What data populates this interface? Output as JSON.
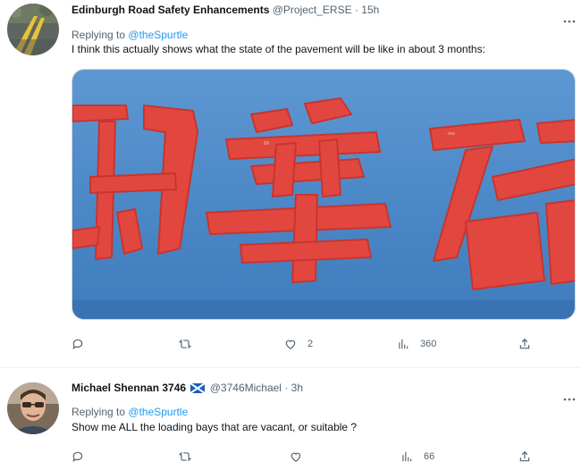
{
  "tweets": [
    {
      "display_name": "Edinburgh Road Safety Enhancements",
      "handle": "@Project_ERSE",
      "separator": "·",
      "time": "15h",
      "replying_prefix": "Replying to",
      "replying_mention": "@theSpurtle",
      "text": "I think this actually shows what the state of the pavement will be like in about 3 months:",
      "actions": {
        "reply": "",
        "retweet": "",
        "like": "2",
        "views": "360",
        "share": ""
      },
      "icons": [
        "reply-icon",
        "retweet-icon",
        "like-icon",
        "views-icon",
        "share-icon",
        "more-icon"
      ]
    },
    {
      "display_name": "Michael Shennan 3746",
      "handle": "@3746Michael",
      "separator": "·",
      "time": "3h",
      "replying_prefix": "Replying to",
      "replying_mention": "@theSpurtle",
      "text": "Show me ALL the loading bays that are vacant, or suitable ?",
      "actions": {
        "reply": "",
        "retweet": "",
        "like": "",
        "views": "66",
        "share": ""
      },
      "icons": [
        "scotland-flag-icon",
        "reply-icon",
        "retweet-icon",
        "like-icon",
        "views-icon",
        "share-icon",
        "more-icon"
      ]
    }
  ],
  "colors": {
    "text": "#0f1419",
    "muted": "#536471",
    "link": "#1d9bf0",
    "sign_blue": "#4a86c5",
    "sign_red": "#e2473f"
  }
}
